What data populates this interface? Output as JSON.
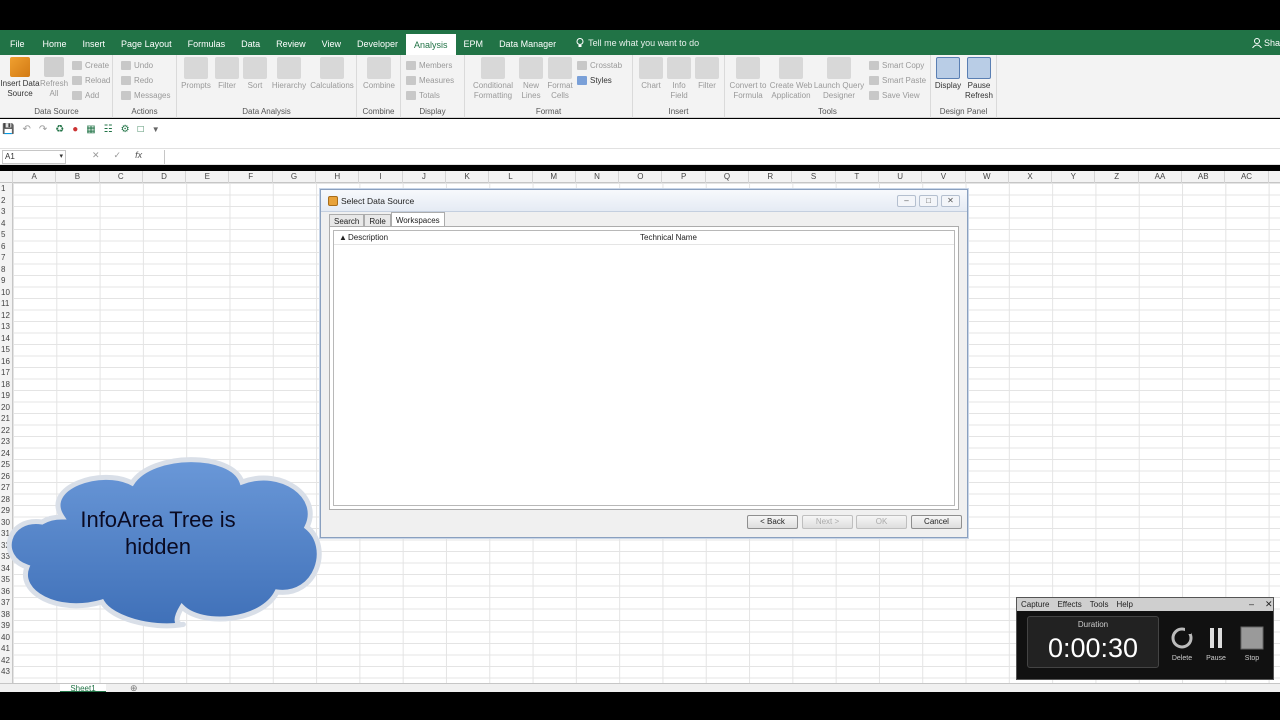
{
  "ribbon_tabs": [
    "File",
    "Home",
    "Insert",
    "Page Layout",
    "Formulas",
    "Data",
    "Review",
    "View",
    "Developer",
    "Analysis",
    "EPM",
    "Data Manager"
  ],
  "active_tab": "Analysis",
  "tell_me": "Tell me what you want to do",
  "user_initials": "Sha",
  "ribbon": {
    "data_source": {
      "label": "Data Source",
      "insert": "Insert Data Source",
      "refresh": "Refresh All"
    },
    "actions": {
      "label": "Actions",
      "create": "Create",
      "reload": "Reload",
      "add": "Add",
      "undo": "Undo",
      "redo": "Redo",
      "messages": "Messages"
    },
    "data_analysis": {
      "label": "Data Analysis",
      "prompts": "Prompts",
      "filter": "Filter",
      "sort": "Sort",
      "hierarchy": "Hierarchy",
      "calculations": "Calculations"
    },
    "combine": {
      "label": "Combine",
      "combine": "Combine"
    },
    "display": {
      "label": "Display",
      "members": "Members",
      "measures": "Measures",
      "totals": "Totals"
    },
    "format": {
      "label": "Format",
      "conditional": "Conditional Formatting",
      "new_lines": "New Lines",
      "format_cells": "Format Cells",
      "crosstab": "Crosstab",
      "styles": "Styles"
    },
    "insert": {
      "label": "Insert",
      "chart": "Chart",
      "info_field": "Info Field",
      "filter": "Filter"
    },
    "tools": {
      "label": "Tools",
      "convert": "Convert to Formula",
      "create_web": "Create Web Application",
      "launch_query": "Launch Query Designer",
      "smart_copy": "Smart Copy",
      "smart_paste": "Smart Paste",
      "save_view": "Save View"
    },
    "design_panel": {
      "label": "Design Panel",
      "display": "Display",
      "pause_refresh": "Pause Refresh"
    }
  },
  "name_box": "A1",
  "columns": [
    "A",
    "B",
    "C",
    "D",
    "E",
    "F",
    "G",
    "H",
    "I",
    "J",
    "K",
    "L",
    "M",
    "N",
    "O",
    "P",
    "Q",
    "R",
    "S",
    "T",
    "U",
    "V",
    "W",
    "X",
    "Y",
    "Z",
    "AA",
    "AB",
    "AC"
  ],
  "rows": [
    "1",
    "2",
    "3",
    "4",
    "5",
    "6",
    "7",
    "8",
    "9",
    "10",
    "11",
    "12",
    "13",
    "14",
    "15",
    "16",
    "17",
    "18",
    "19",
    "20",
    "21",
    "22",
    "23",
    "24",
    "25",
    "26",
    "27",
    "28",
    "29",
    "30",
    "31",
    "32",
    "33",
    "34",
    "35",
    "36",
    "37",
    "38",
    "39",
    "40",
    "41",
    "42",
    "43"
  ],
  "sheet_tab": "Sheet1",
  "dialog": {
    "title": "Select Data Source",
    "tabs": [
      "Search",
      "Role",
      "Workspaces"
    ],
    "active_tab": "Workspaces",
    "col_description": "Description",
    "col_technical": "Technical Name",
    "back": "< Back",
    "next": "Next >",
    "ok": "OK",
    "cancel": "Cancel"
  },
  "callout": {
    "line1": "InfoArea Tree is",
    "line2": "hidden",
    "fill": "#4f83c9"
  },
  "recorder": {
    "menu": [
      "Capture",
      "Effects",
      "Tools",
      "Help"
    ],
    "duration_label": "Duration",
    "time": "0:00:30",
    "delete": "Delete",
    "pause": "Pause",
    "stop": "Stop"
  },
  "colors": {
    "excel_green": "#217346",
    "ribbon_bg": "#f3f3f3"
  }
}
